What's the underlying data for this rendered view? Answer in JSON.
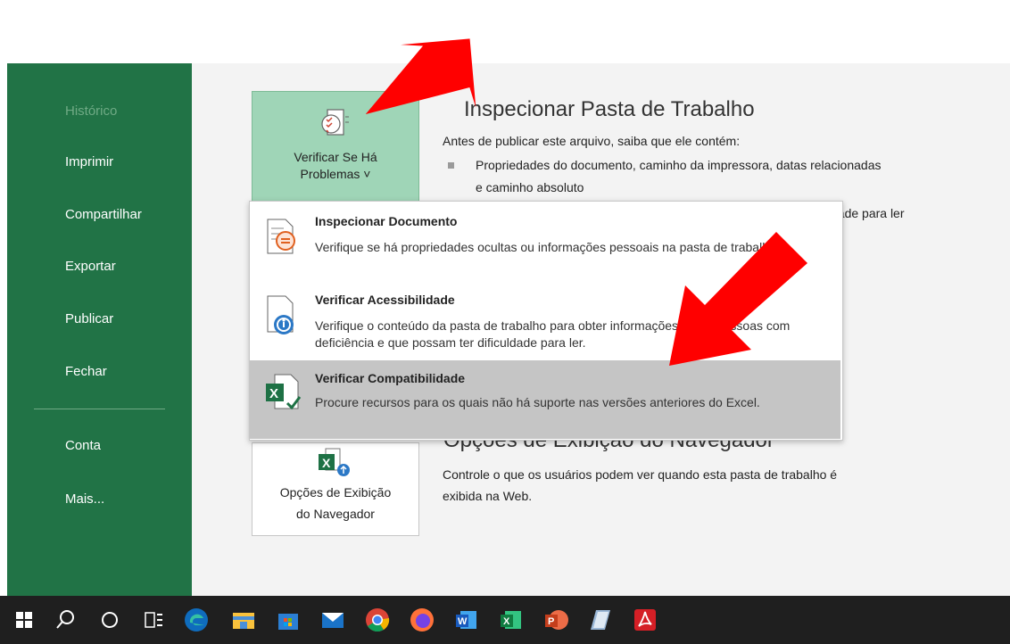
{
  "sidebar": {
    "items": [
      {
        "label": "Histórico",
        "disabled": true
      },
      {
        "label": "Imprimir"
      },
      {
        "label": "Compartilhar"
      },
      {
        "label": "Exportar"
      },
      {
        "label": "Publicar"
      },
      {
        "label": "Fechar"
      },
      {
        "label": "Conta"
      },
      {
        "label": "Mais..."
      }
    ]
  },
  "inspect": {
    "button_line1": "Verificar Se Há",
    "button_line2": "Problemas ˅",
    "title_visible": "Inspecionar Pasta de Trabalho",
    "intro": "Antes de publicar este arquivo, saiba que ele contém:",
    "bullet1_line1": "Propriedades do documento, caminho da impressora, datas relacionadas",
    "bullet1_line2": "e caminho absoluto",
    "bullet2_tail": "dade para ler"
  },
  "menu": {
    "items": [
      {
        "title": "Inspecionar Documento",
        "desc": "Verifique se há propriedades ocultas ou informações pessoais na pasta de trabalho.",
        "icon": "inspect-document-icon"
      },
      {
        "title": "Verificar Acessibilidade",
        "desc": "Verifique o conteúdo da pasta de trabalho para obter informações sobre pessoas com deficiência e que possam ter dificuldade para ler.",
        "icon": "accessibility-icon"
      },
      {
        "title": "Verificar Compatibilidade",
        "desc": "Procure recursos para os quais não há suporte nas versões anteriores do Excel.",
        "icon": "compatibility-icon",
        "highlighted": true
      }
    ]
  },
  "browser": {
    "button_line1": "Opções de Exibição",
    "button_line2": "do Navegador",
    "title": "Opções de Exibição do Navegador",
    "desc_line1": "Controle o que os usuários podem ver quando esta pasta de trabalho é",
    "desc_line2": "exibida na Web."
  },
  "colors": {
    "sidebar": "#217346",
    "button_active": "#9fd5b7",
    "menu_highlight": "#c5c5c5",
    "arrow": "#ff0000",
    "taskbar": "#1f1f1f"
  },
  "taskbar": {
    "icons": [
      "windows-start-icon",
      "search-icon",
      "cortana-icon",
      "task-view-icon",
      "edge-icon",
      "file-explorer-icon",
      "store-icon",
      "mail-icon",
      "chrome-icon",
      "firefox-icon",
      "word-icon",
      "excel-icon",
      "powerpoint-icon",
      "notes-icon",
      "acrobat-icon"
    ]
  }
}
